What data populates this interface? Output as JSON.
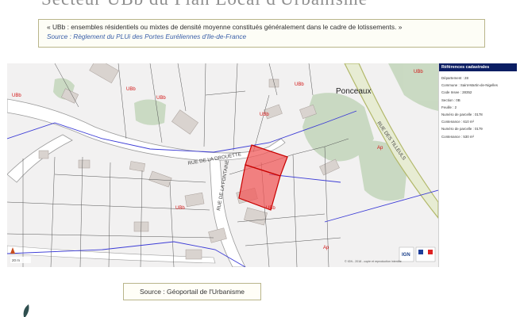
{
  "page": {
    "title": "Secteur UBb du Plan Local d'Urbanisme"
  },
  "quote": {
    "text": "« UBb : ensembles résidentiels ou mixtes de densité moyenne constitués généralement dans le cadre de lotissements. »",
    "source": "Source : Règlement du PLUi des Portes Euréliennes d'Ile-de-France"
  },
  "map": {
    "zones": [
      "UBb",
      "UBb",
      "UBb",
      "UBb",
      "UBb",
      "UBb",
      "UBb",
      "UBb",
      "Ap",
      "Ap"
    ],
    "place_name": "Ponceaux",
    "streets": [
      "RUE DE LA DROUETTE",
      "RUE DE LA FONTAINE",
      "RUE DES TILLEULS"
    ],
    "highlight_color": "#f05a5a",
    "credit": "© IGN - 2018 - copie et reproduction interdite",
    "logo_text": "IGN",
    "scale_label": "20 m"
  },
  "references": {
    "header": "Références cadastrales",
    "rows": [
      "Département : 28",
      "Commune : Saint-Martin-de-Nigelles",
      "Code Insee : 28352",
      "Section : 0B",
      "Feuille : 2",
      "Numéro de parcelle : 0178",
      "Contenance : 610 m²",
      "Numéro de parcelle : 0179",
      "Contenance : 530 m²"
    ]
  },
  "footer": {
    "source": "Source : Géoportail de l'Urbanisme"
  }
}
